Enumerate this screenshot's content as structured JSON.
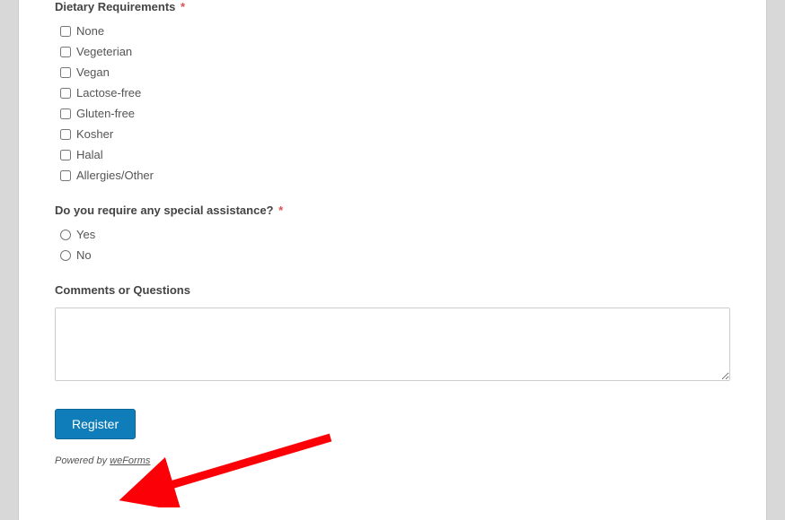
{
  "dietary": {
    "label": "Dietary Requirements",
    "required": "*",
    "options": [
      "None",
      "Vegeterian",
      "Vegan",
      "Lactose-free",
      "Gluten-free",
      "Kosher",
      "Halal",
      "Allergies/Other"
    ]
  },
  "assistance": {
    "label": "Do you require any special assistance?",
    "required": "*",
    "options": [
      "Yes",
      "No"
    ]
  },
  "comments": {
    "label": "Comments or Questions"
  },
  "submit": {
    "label": "Register"
  },
  "footer": {
    "prefix": "Powered by ",
    "link": "weForms"
  }
}
